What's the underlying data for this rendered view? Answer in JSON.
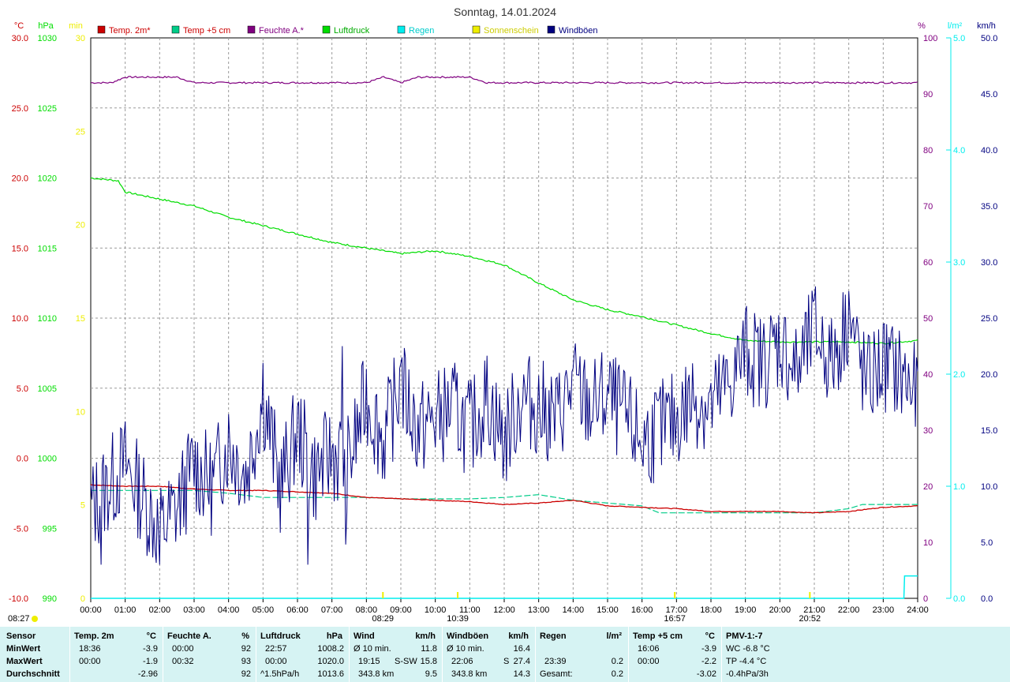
{
  "header": {
    "title": "Sonntag, 14.01.2024",
    "left_units": [
      "°C",
      "hPa",
      "min"
    ],
    "right_units": [
      "%",
      "l/m²",
      "km/h"
    ]
  },
  "legend": [
    {
      "label": "Temp. 2m*",
      "color": "#cc0000",
      "text_color": "#cc0000"
    },
    {
      "label": "Temp +5 cm",
      "color": "#00cc88",
      "text_color": "#cc0000"
    },
    {
      "label": "Feuchte A.*",
      "color": "#800080",
      "text_color": "#800080"
    },
    {
      "label": "Luftdruck",
      "color": "#00dd00",
      "text_color": "#00aa00"
    },
    {
      "label": "Regen",
      "color": "#00eeee",
      "text_color": "#00cccc"
    },
    {
      "label": "Sonnenschein",
      "color": "#eeee00",
      "text_color": "#cccc00"
    },
    {
      "label": "Windböen",
      "color": "#000080",
      "text_color": "#000080"
    }
  ],
  "colors": {
    "temp": "#cc0000",
    "temp5": "#00cc88",
    "humidity": "#800080",
    "pressure": "#00dd00",
    "rain": "#00eeee",
    "sunshine": "#eeee00",
    "gusts": "#000080",
    "minutes": "#eeee00",
    "grid": "#999999",
    "stats_bg": "#d6f3f3"
  },
  "chart_data": {
    "type": "line",
    "title": "Sonntag, 14.01.2024",
    "x_ticks": [
      "00:00",
      "01:00",
      "02:00",
      "03:00",
      "04:00",
      "05:00",
      "06:00",
      "07:00",
      "08:00",
      "09:00",
      "10:00",
      "11:00",
      "12:00",
      "13:00",
      "14:00",
      "15:00",
      "16:00",
      "17:00",
      "18:00",
      "19:00",
      "20:00",
      "21:00",
      "22:00",
      "23:00",
      "24:00"
    ],
    "axes": {
      "temp": {
        "unit": "°C",
        "ylim": [
          -10,
          30
        ],
        "ticks": [
          "30.0",
          "25.0",
          "20.0",
          "15.0",
          "10.0",
          "5.0",
          "0.0",
          "-5.0",
          "-10.0"
        ]
      },
      "pressure": {
        "unit": "hPa",
        "ylim": [
          990,
          1030
        ],
        "ticks": [
          "1030",
          "1025",
          "1020",
          "1015",
          "1010",
          "1005",
          "1000",
          "995",
          "990"
        ]
      },
      "minutes": {
        "unit": "min",
        "ylim": [
          0,
          30
        ],
        "ticks": [
          "30",
          "25",
          "20",
          "15",
          "10",
          "5",
          "0"
        ]
      },
      "humidity": {
        "unit": "%",
        "ylim": [
          0,
          100
        ],
        "ticks": [
          "100",
          "90",
          "80",
          "70",
          "60",
          "50",
          "40",
          "30",
          "20",
          "10",
          "0"
        ]
      },
      "rain": {
        "unit": "l/m²",
        "ylim": [
          0,
          5
        ],
        "ticks": [
          "5.0",
          "4.0",
          "3.0",
          "2.0",
          "1.0",
          "0.0"
        ]
      },
      "wind": {
        "unit": "km/h",
        "ylim": [
          0,
          50
        ],
        "ticks": [
          "50.0",
          "45.0",
          "40.0",
          "35.0",
          "30.0",
          "25.0",
          "20.0",
          "15.0",
          "10.0",
          "5.0",
          "0.0"
        ]
      }
    },
    "series": [
      {
        "name": "Temp. 2m*",
        "axis": "temp",
        "x": [
          0,
          1,
          2,
          3,
          4,
          5,
          6,
          7,
          8,
          9,
          10,
          11,
          12,
          13,
          14,
          15,
          16,
          17,
          18,
          19,
          20,
          21,
          22,
          23,
          24
        ],
        "values": [
          -1.9,
          -2.0,
          -2.0,
          -2.2,
          -2.3,
          -2.3,
          -2.4,
          -2.5,
          -2.8,
          -2.9,
          -3.0,
          -3.1,
          -3.3,
          -3.2,
          -3.0,
          -3.4,
          -3.5,
          -3.6,
          -3.8,
          -3.8,
          -3.8,
          -3.9,
          -3.8,
          -3.5,
          -3.4
        ]
      },
      {
        "name": "Temp +5 cm",
        "axis": "temp",
        "x": [
          0,
          1,
          2,
          3,
          4,
          5,
          6,
          7,
          8,
          9,
          10,
          11,
          12,
          13,
          14,
          15,
          16,
          16.5,
          17,
          18,
          19,
          20,
          21,
          22,
          22.4,
          23,
          24
        ],
        "values": [
          -2.3,
          -2.3,
          -2.3,
          -2.3,
          -2.5,
          -2.8,
          -2.8,
          -2.8,
          -2.8,
          -2.9,
          -2.9,
          -2.9,
          -2.8,
          -2.6,
          -3.0,
          -3.2,
          -3.4,
          -3.9,
          -3.9,
          -3.9,
          -3.9,
          -3.9,
          -3.9,
          -3.6,
          -3.3,
          -3.3,
          -3.3
        ]
      },
      {
        "name": "Feuchte A.*",
        "axis": "humidity",
        "x": [
          0,
          0.6,
          1.0,
          2.0,
          2.5,
          3.0,
          4.0,
          5.0,
          6.0,
          7.0,
          8.0,
          8.5,
          9.0,
          9.5,
          10,
          11,
          11.5,
          12,
          13,
          14,
          15,
          16,
          17,
          18,
          19,
          20,
          21,
          22,
          23,
          24
        ],
        "values": [
          92,
          92,
          93,
          93,
          93,
          92,
          92,
          92,
          92,
          92,
          92,
          93,
          92,
          93,
          93,
          93,
          92,
          92,
          92,
          92,
          92,
          92,
          92,
          92,
          92,
          92,
          92,
          92,
          92,
          92
        ]
      },
      {
        "name": "Luftdruck",
        "axis": "pressure",
        "x": [
          0,
          0.8,
          1,
          2,
          3,
          4,
          5,
          6,
          7,
          8,
          9,
          10,
          11,
          12,
          13,
          14,
          15,
          16,
          17,
          18,
          19,
          20,
          21,
          22,
          23,
          24
        ],
        "values": [
          1020.0,
          1019.8,
          1019.0,
          1018.5,
          1018.0,
          1017.2,
          1016.6,
          1016.0,
          1015.4,
          1015.0,
          1014.6,
          1014.8,
          1014.4,
          1013.8,
          1012.5,
          1011.3,
          1010.6,
          1010.1,
          1009.5,
          1008.9,
          1008.4,
          1008.3,
          1008.3,
          1008.3,
          1008.2,
          1008.4
        ]
      },
      {
        "name": "Regen",
        "axis": "rain",
        "x": [
          0,
          23.6,
          23.62,
          23.9,
          23.92,
          24
        ],
        "values": [
          0,
          0,
          0.2,
          0.2,
          0.2,
          0.2
        ]
      },
      {
        "name": "Windböen",
        "axis": "wind",
        "x": [
          0,
          0.5,
          1,
          1.5,
          2,
          2.5,
          3,
          3.5,
          4,
          4.5,
          5,
          5.5,
          6,
          6.5,
          7,
          7.5,
          8,
          8.5,
          9,
          9.5,
          10,
          10.5,
          11,
          11.5,
          12,
          12.5,
          13,
          13.5,
          14,
          14.5,
          15,
          15.5,
          16,
          16.5,
          17,
          17.5,
          18,
          18.5,
          19,
          19.5,
          20,
          20.5,
          21,
          21.5,
          22,
          22.5,
          23,
          23.5,
          24
        ],
        "values": [
          8,
          10,
          12,
          9,
          6,
          8,
          12,
          10,
          14,
          11,
          18,
          10,
          15,
          11,
          13,
          12,
          18,
          14,
          19,
          15,
          16,
          17,
          15,
          18,
          14,
          18,
          17,
          16,
          19,
          17,
          18,
          16,
          14,
          15,
          16,
          18,
          17,
          19,
          22,
          21,
          23,
          20,
          24,
          21,
          25,
          19,
          21,
          20,
          18
        ],
        "spikes": [
          {
            "x": 5.0,
            "y": 21
          },
          {
            "x": 7.3,
            "y": 22.5
          },
          {
            "x": 9.0,
            "y": 21
          },
          {
            "x": 19.0,
            "y": 25.5
          },
          {
            "x": 20.75,
            "y": 25.5
          },
          {
            "x": 22.0,
            "y": 27.4
          },
          {
            "x": 0.3,
            "y": 3
          },
          {
            "x": 2.0,
            "y": 3
          },
          {
            "x": 6.3,
            "y": 3
          },
          {
            "x": 7.4,
            "y": 4.8
          }
        ]
      }
    ],
    "sun_markers": [
      {
        "label": "08:27",
        "x": 0,
        "kind": "sunrise"
      },
      {
        "label": "08:29",
        "x": 8.48
      },
      {
        "label": "10:39",
        "x": 10.65
      },
      {
        "label": "16:57",
        "x": 16.95
      },
      {
        "label": "20:52",
        "x": 20.87
      }
    ]
  },
  "stats": {
    "row_labels": {
      "sensor": "Sensor",
      "min": "MinWert",
      "max": "MaxWert",
      "avg": "Durchschnitt"
    },
    "temp2m": {
      "title": "Temp. 2m",
      "unit": "°C",
      "min_time": "18:36",
      "min_val": "-3.9",
      "max_time": "00:00",
      "max_val": "-1.9",
      "avg_val": "-2.96"
    },
    "humidity": {
      "title": "Feuchte A.",
      "unit": "%",
      "min_time": "00:00",
      "min_val": "92",
      "max_time": "00:32",
      "max_val": "93",
      "avg_val": "92"
    },
    "pressure": {
      "title": "Luftdruck",
      "unit": "hPa",
      "min_time": "22:57",
      "min_val": "1008.2",
      "max_time": "00:00",
      "max_val": "1020.0",
      "avg_time": "^1.5hPa/h",
      "avg_val": "1013.6"
    },
    "wind": {
      "title": "Wind",
      "unit": "km/h",
      "min_time": "Ø 10 min.",
      "min_val": "11.8",
      "max_time": "19:15",
      "max_dir": "S-SW",
      "max_val": "15.8",
      "avg_time": "343.8 km",
      "avg_val": "9.5"
    },
    "gusts": {
      "title": "Windböen",
      "unit": "km/h",
      "min_time": "Ø 10 min.",
      "min_val": "16.4",
      "max_time": "22:06",
      "max_dir": "S",
      "max_val": "27.4",
      "avg_time": "343.8 km",
      "avg_val": "14.3"
    },
    "rain": {
      "title": "Regen",
      "unit": "l/m²",
      "max_time": "23:39",
      "max_val": "0.2",
      "avg_time": "Gesamt:",
      "avg_val": "0.2"
    },
    "temp5": {
      "title": "Temp +5 cm",
      "unit": "°C",
      "min_time": "16:06",
      "min_val": "-3.9",
      "max_time": "00:00",
      "max_val": "-2.2",
      "avg_val": "-3.02"
    },
    "pmv": {
      "title": "PMV-1:-7",
      "line1": "WC -6.8 °C",
      "line2": "TP -4.4 °C",
      "line3": "-0.4hPa/3h"
    }
  }
}
